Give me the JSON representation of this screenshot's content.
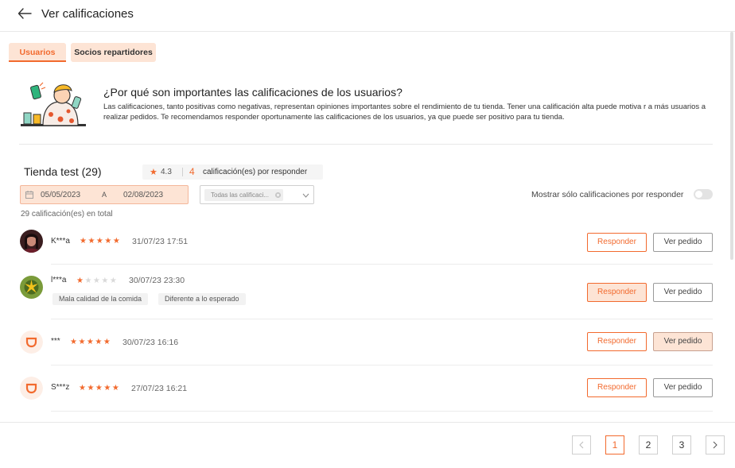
{
  "header": {
    "title": "Ver calificaciones"
  },
  "tabs": [
    {
      "label": "Usuarios",
      "active": true
    },
    {
      "label": "Socios repartidores",
      "active": false
    }
  ],
  "info": {
    "title": "¿Por qué son importantes las calificaciones de los usuarios?",
    "description": "Las calificaciones, tanto positivas como negativas, representan opiniones importantes sobre el rendimiento de tu tienda. Tener una calificación alta puede motiva r a más usuarios a realizar pedidos. Te recomendamos responder oportunamente las calificaciones de los usuarios, ya que puede ser positivo para tu tienda."
  },
  "store": {
    "title": "Tienda test (29)",
    "rating": "4.3",
    "pending_count": "4",
    "pending_label": "calificación(es) por responder"
  },
  "filters": {
    "date_start": "05/05/2023",
    "date_separator": "A",
    "date_end": "02/08/2023",
    "rating_chip": "Todas las calificaci...",
    "toggle_label": "Mostrar sólo calificaciones por responder",
    "toggle_on": false
  },
  "total_label": "29 calificación(es) en total",
  "reviews": [
    {
      "name": "K***a",
      "stars": 5,
      "date": "31/07/23 17:51",
      "tags": [],
      "avatar": "photo-woman"
    },
    {
      "name": "l***a",
      "stars": 1,
      "date": "30/07/23 23:30",
      "tags": [
        "Mala calidad de la comida",
        "Diferente a lo esperado"
      ],
      "avatar": "photo-plant"
    },
    {
      "name": "***",
      "stars": 5,
      "date": "30/07/23 16:16",
      "tags": [],
      "avatar": "default-logo"
    },
    {
      "name": "S***z",
      "stars": 5,
      "date": "27/07/23 16:21",
      "tags": [],
      "avatar": "default-logo"
    }
  ],
  "actions": {
    "reply": "Responder",
    "view_order": "Ver pedido"
  },
  "pagination": {
    "pages": [
      "1",
      "2",
      "3"
    ],
    "current": "1"
  },
  "colors": {
    "accent": "#f26a2e",
    "accent_light": "#fde4d5"
  }
}
